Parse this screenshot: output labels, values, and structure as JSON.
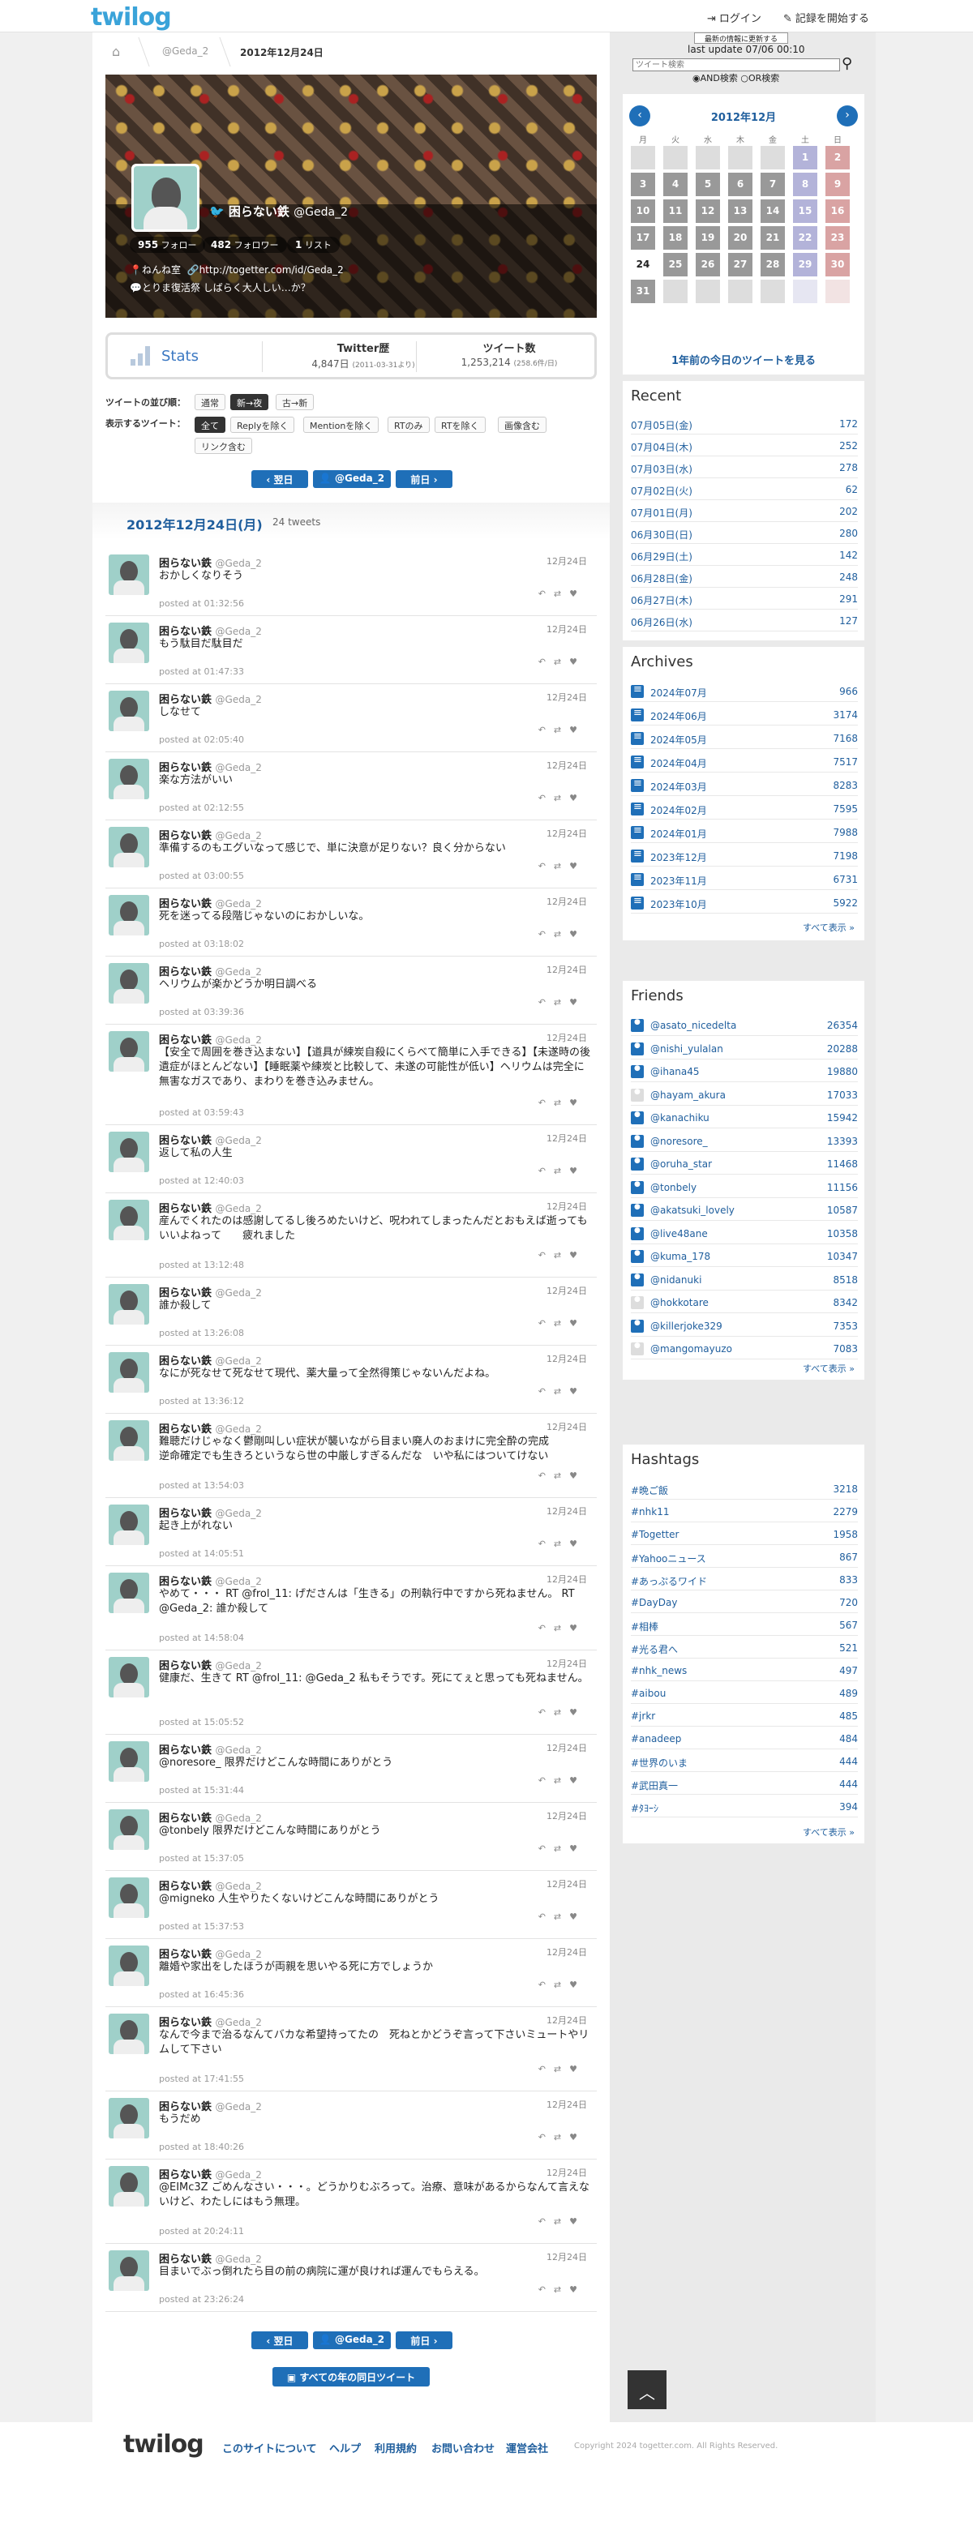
{
  "header": {
    "logo": "twilog",
    "login": "ログイン",
    "start_record": "記録を開始する"
  },
  "breadcrumb": {
    "user": "@Geda_2",
    "date": "2012年12月24日"
  },
  "profile": {
    "name": "困らない鉄",
    "handle": "@Geda_2",
    "follow_count": "955",
    "follow_label": "フォロー",
    "follower_count": "482",
    "follower_label": "フォロワー",
    "list_count": "1",
    "list_label": "リスト",
    "location": "ねんね室",
    "url": "http://togetter.com/id/Geda_2",
    "bio": "とりま復活祭 しばらく大人しい…か？"
  },
  "stats": {
    "label": "Stats",
    "twitter_years_label": "Twitter歴",
    "twitter_years_value": "4,847日",
    "twitter_years_note": "(2011-03-31より)",
    "tweet_count_label": "ツイート数",
    "tweet_count_value": "1,253,214",
    "tweet_count_note": "(258.6件/日)"
  },
  "options": {
    "order_label": "ツイートの並び順：",
    "order": [
      "通常",
      "新→夜",
      "古→新"
    ],
    "filter_label": "表示するツイート：",
    "filters": [
      "全て",
      "Replyを除く",
      "Mentionを除く",
      "RTのみ",
      "RTを除く",
      "画像含む",
      "リンク含む"
    ]
  },
  "pager": {
    "prev": "翌日",
    "user": "@Geda_2",
    "next": "前日"
  },
  "day": {
    "title": "2012年12月24日(月)",
    "count": "24 tweets"
  },
  "tweets": [
    {
      "text": "おかしくなりそう",
      "time": "posted at 01:32:56"
    },
    {
      "text": "もう駄目だ駄目だ",
      "time": "posted at 01:47:33"
    },
    {
      "text": "しなせて",
      "time": "posted at 02:05:40"
    },
    {
      "text": "楽な方法がいい",
      "time": "posted at 02:12:55"
    },
    {
      "text": "準備するのもエグいなって感じで、単に決意が足りない？良く分からない",
      "time": "posted at 03:00:55"
    },
    {
      "text": "死を迷ってる段階じゃないのにおかしいな。",
      "time": "posted at 03:18:02"
    },
    {
      "text": "ヘリウムが楽かどうか明日調べる",
      "time": "posted at 03:39:36"
    },
    {
      "text": "【安全で周囲を巻き込まない】【道具が練炭自殺にくらべて簡単に入手できる】【未遂時の後遺症がほとんどない】【睡眠薬や練炭と比較して、未遂の可能性が低い】ヘリウムは完全に無害なガスであり、まわりを巻き込みません。",
      "time": "posted at 03:59:43"
    },
    {
      "text": "返して私の人生",
      "time": "posted at 12:40:03"
    },
    {
      "text": "産んでくれたのは感謝してるし後ろめたいけど、呪われてしまったんだとおもえば逝ってもいいよねって　　疲れました",
      "time": "posted at 13:12:48"
    },
    {
      "text": "誰か殺して",
      "time": "posted at 13:26:08"
    },
    {
      "text": "なにが死なせて死なせて現代、薬大量って全然得策じゃないんだよね。",
      "time": "posted at 13:36:12"
    },
    {
      "text": "難聴だけじゃなく鬱剛叫しい症状が襲いながら目まい廃人のおまけに完全酔の完成\n逆命確定でも生きろというなら世の中厳しすぎるんだな　いや私にはついてけない",
      "time": "posted at 13:54:03"
    },
    {
      "text": "起き上がれない",
      "time": "posted at 14:05:51"
    },
    {
      "text": "やめて・・・ RT @frol_11: げださんは「生きる」の刑執行中ですから死ねません。 RT @Geda_2: 誰か殺して",
      "time": "posted at 14:58:04"
    },
    {
      "text": "健康だ、生きて RT @frol_11: @Geda_2 私もそうです。死にてぇと思っても死ねません。",
      "time": "posted at 15:05:52"
    },
    {
      "text": "@noresore_ 限界だけどこんな時間にありがとう",
      "time": "posted at 15:31:44"
    },
    {
      "text": "@tonbely 限界だけどこんな時間にありがとう",
      "time": "posted at 15:37:05"
    },
    {
      "text": "@migneko 人生やりたくないけどこんな時間にありがとう",
      "time": "posted at 15:37:53"
    },
    {
      "text": "離婚や家出をしたほうが両親を思いやる死に方でしょうか",
      "time": "posted at 16:45:36"
    },
    {
      "text": "なんで今まで治るなんてバカな希望持ってたの　死ねとかどうぞ言って下さいミュートやリムして下さい",
      "time": "posted at 17:41:55"
    },
    {
      "text": "もうだめ",
      "time": "posted at 18:40:26"
    },
    {
      "text": "@EIMc3Z ごめんなさい・・・。どうかりむぶろって。治療、意味があるからなんて言えないけど、わたしにはもう無理。",
      "time": "posted at 20:24:11"
    },
    {
      "text": "目まいでぶっ倒れたら目の前の病院に運が良ければ運んでもらえる。",
      "time": "posted at 23:26:24"
    }
  ],
  "tweet_date": "12月24日",
  "all_years_button": "すべての年の同日ツイート",
  "search": {
    "refresh_note": "最新の情報に更新する",
    "last_update": "last update 07/06 00:10",
    "placeholder": "ツイート検索",
    "and_label": "AND検索",
    "or_label": "OR検索"
  },
  "calendar": {
    "title": "2012年12月",
    "weekdays": [
      "月",
      "火",
      "水",
      "木",
      "金",
      "土",
      "日"
    ],
    "days": [
      "",
      "",
      "",
      "",
      "",
      "1",
      "2",
      "3",
      "4",
      "5",
      "6",
      "7",
      "8",
      "9",
      "10",
      "11",
      "12",
      "13",
      "14",
      "15",
      "16",
      "17",
      "18",
      "19",
      "20",
      "21",
      "22",
      "23",
      "24",
      "25",
      "26",
      "27",
      "28",
      "29",
      "30",
      "31",
      "",
      "",
      "",
      "",
      "",
      ""
    ],
    "link": "1年前の今日のツイートを見る"
  },
  "recent": {
    "title": "Recent",
    "items": [
      {
        "label": "07月05日(金)",
        "count": "172"
      },
      {
        "label": "07月04日(木)",
        "count": "252"
      },
      {
        "label": "07月03日(水)",
        "count": "278"
      },
      {
        "label": "07月02日(火)",
        "count": "62"
      },
      {
        "label": "07月01日(月)",
        "count": "202"
      },
      {
        "label": "06月30日(日)",
        "count": "280"
      },
      {
        "label": "06月29日(土)",
        "count": "142"
      },
      {
        "label": "06月28日(金)",
        "count": "248"
      },
      {
        "label": "06月27日(木)",
        "count": "291"
      },
      {
        "label": "06月26日(水)",
        "count": "127"
      }
    ]
  },
  "archives": {
    "title": "Archives",
    "items": [
      {
        "label": "2024年07月",
        "count": "966"
      },
      {
        "label": "2024年06月",
        "count": "3174"
      },
      {
        "label": "2024年05月",
        "count": "7168"
      },
      {
        "label": "2024年04月",
        "count": "7517"
      },
      {
        "label": "2024年03月",
        "count": "8283"
      },
      {
        "label": "2024年02月",
        "count": "7595"
      },
      {
        "label": "2024年01月",
        "count": "7988"
      },
      {
        "label": "2023年12月",
        "count": "7198"
      },
      {
        "label": "2023年11月",
        "count": "6731"
      },
      {
        "label": "2023年10月",
        "count": "5922"
      }
    ],
    "more": "すべて表示 »"
  },
  "friends": {
    "title": "Friends",
    "items": [
      {
        "label": "@asato_nicedelta",
        "count": "26354"
      },
      {
        "label": "@nishi_yulalan",
        "count": "20288"
      },
      {
        "label": "@ihana45",
        "count": "19880"
      },
      {
        "label": "@hayam_akura",
        "count": "17033"
      },
      {
        "label": "@kanachiku",
        "count": "15942"
      },
      {
        "label": "@noresore_",
        "count": "13393"
      },
      {
        "label": "@oruha_star",
        "count": "11468"
      },
      {
        "label": "@tonbely",
        "count": "11156"
      },
      {
        "label": "@akatsuki_lovely",
        "count": "10587"
      },
      {
        "label": "@live48ane",
        "count": "10358"
      },
      {
        "label": "@kuma_178",
        "count": "10347"
      },
      {
        "label": "@nidanuki",
        "count": "8518"
      },
      {
        "label": "@hokkotare",
        "count": "8342"
      },
      {
        "label": "@killerjoke329",
        "count": "7353"
      },
      {
        "label": "@mangomayuzo",
        "count": "7083"
      }
    ],
    "more": "すべて表示 »"
  },
  "hashtags": {
    "title": "Hashtags",
    "items": [
      {
        "label": "#晩ご飯",
        "count": "3218"
      },
      {
        "label": "#nhk11",
        "count": "2279"
      },
      {
        "label": "#Togetter",
        "count": "1958"
      },
      {
        "label": "#Yahooニュース",
        "count": "867"
      },
      {
        "label": "#あっぷるワイド",
        "count": "833"
      },
      {
        "label": "#DayDay",
        "count": "720"
      },
      {
        "label": "#相棒",
        "count": "567"
      },
      {
        "label": "#光る君へ",
        "count": "521"
      },
      {
        "label": "#nhk_news",
        "count": "497"
      },
      {
        "label": "#aibou",
        "count": "489"
      },
      {
        "label": "#jrkr",
        "count": "485"
      },
      {
        "label": "#anadeep",
        "count": "484"
      },
      {
        "label": "#世界のいま",
        "count": "444"
      },
      {
        "label": "#武田真一",
        "count": "444"
      },
      {
        "label": "#ﾀﾖｰｼ",
        "count": "394"
      }
    ],
    "more": "すべて表示 »"
  },
  "footer": {
    "logo": "twilog",
    "links": [
      "このサイトについて",
      "ヘルプ",
      "利用規約",
      "お問い合わせ",
      "運営会社"
    ],
    "copyright": "Copyright 2024 togetter.com. All Rights Reserved."
  }
}
